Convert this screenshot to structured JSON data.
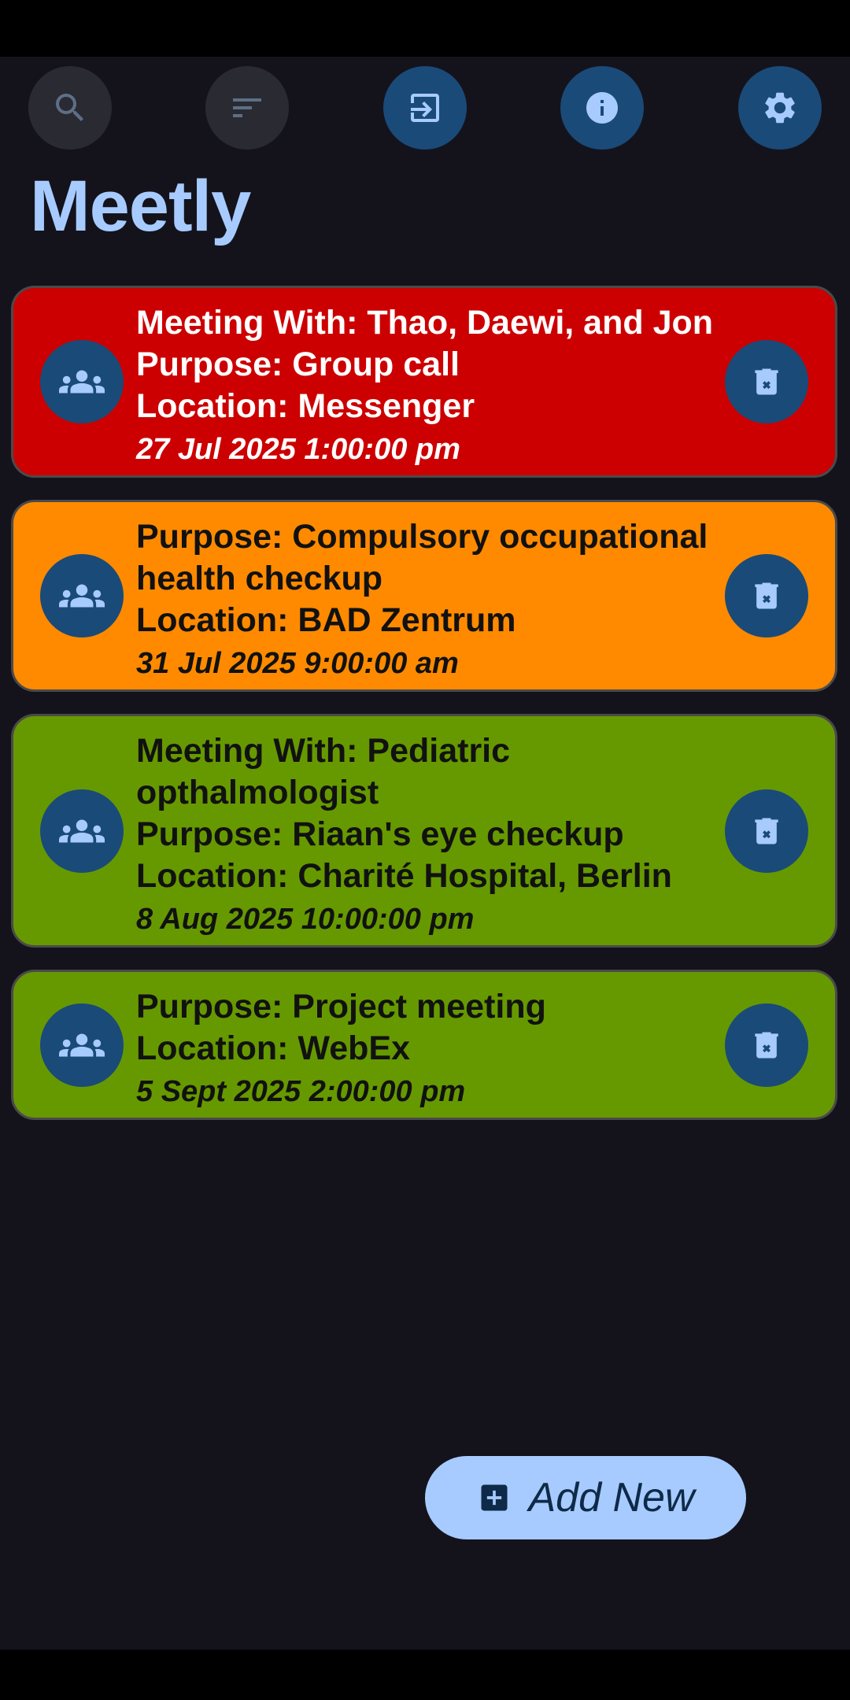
{
  "app": {
    "title": "Meetly"
  },
  "toolbar": {
    "buttons": [
      {
        "icon": "search-icon",
        "enabled": false
      },
      {
        "icon": "sort-icon",
        "enabled": false
      },
      {
        "icon": "import-icon",
        "enabled": true
      },
      {
        "icon": "info-icon",
        "enabled": true
      },
      {
        "icon": "settings-icon",
        "enabled": true
      }
    ]
  },
  "meetings": [
    {
      "lines": [
        "Meeting With: Thao, Daewi, and Jon",
        "Purpose: Group call",
        "Location: Messenger"
      ],
      "date": "27 Jul 2025 1:00:00 pm",
      "bg": "#cc0000",
      "text_color": "#ffffff"
    },
    {
      "lines": [
        "Purpose: Compulsory occupational",
        "health checkup",
        "Location: BAD Zentrum"
      ],
      "date": "31 Jul 2025 9:00:00 am",
      "bg": "#ff8a00",
      "text_color": "#111111"
    },
    {
      "lines": [
        "Meeting With: Pediatric",
        "opthalmologist",
        "Purpose: Riaan's eye checkup",
        "Location: Charité Hospital, Berlin"
      ],
      "date": "8 Aug 2025 10:00:00 pm",
      "bg": "#669900",
      "text_color": "#111111"
    },
    {
      "lines": [
        "Purpose: Project meeting",
        "Location: WebEx"
      ],
      "date": "5 Sept 2025 2:00:00 pm",
      "bg": "#669900",
      "text_color": "#111111"
    }
  ],
  "fab": {
    "label": "Add New",
    "icon": "add-box-icon"
  },
  "colors": {
    "background": "#14131c",
    "accent": "#a7cbff",
    "button": "#1a4a78"
  }
}
